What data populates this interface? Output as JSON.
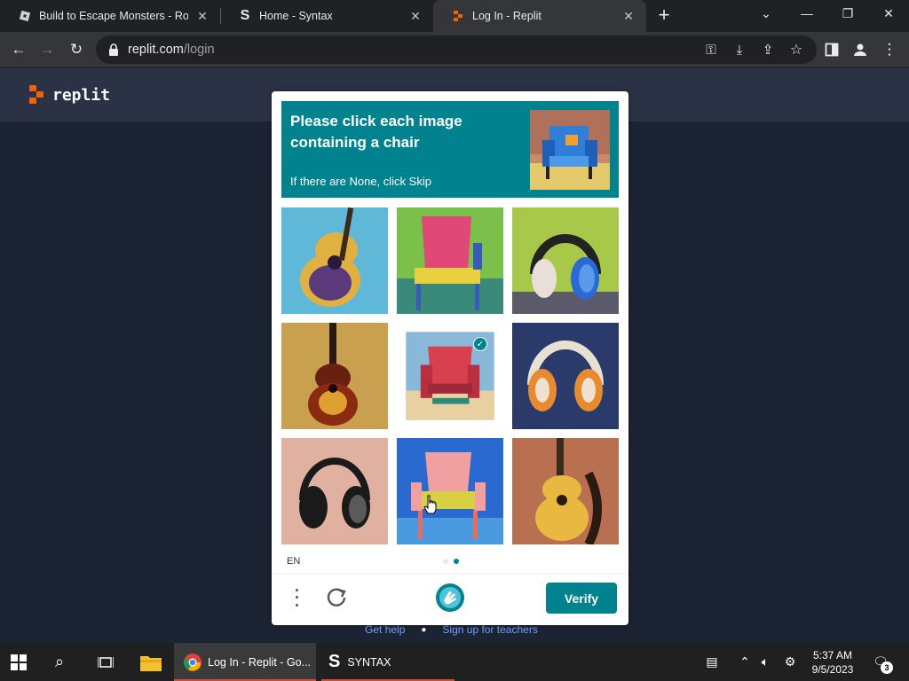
{
  "browser": {
    "tabs": [
      {
        "title": "Build to Escape Monsters - Roblox",
        "active": false,
        "favicon": "roblox-icon"
      },
      {
        "title": "Home - Syntax",
        "active": false,
        "favicon": "syntax-s-icon"
      },
      {
        "title": "Log In - Replit",
        "active": true,
        "favicon": "replit-icon"
      }
    ],
    "url_host": "replit.com",
    "url_path": "/login"
  },
  "page": {
    "brand": "replit",
    "links": {
      "help": "Get help",
      "teachers": "Sign up for teachers"
    }
  },
  "captcha": {
    "prompt_title": "Please click each image containing a chair",
    "prompt_sub": "If there are None, click Skip",
    "prompt_example": "chair",
    "images": [
      {
        "subject": "guitar",
        "selected": false
      },
      {
        "subject": "chair",
        "selected": false
      },
      {
        "subject": "headphones",
        "selected": false
      },
      {
        "subject": "guitar",
        "selected": false
      },
      {
        "subject": "chair",
        "selected": true
      },
      {
        "subject": "headphones",
        "selected": false
      },
      {
        "subject": "headphones",
        "selected": false
      },
      {
        "subject": "chair",
        "selected": false
      },
      {
        "subject": "guitar",
        "selected": false
      }
    ],
    "language": "EN",
    "verify_label": "Verify",
    "page_indicator": {
      "total": 2,
      "current": 2
    },
    "accent_color": "#00838f"
  },
  "taskbar": {
    "chrome_label": "Log In - Replit - Go...",
    "syntax_label": "SYNTAX",
    "time": "5:37 AM",
    "date": "9/5/2023",
    "notifications": "3"
  }
}
